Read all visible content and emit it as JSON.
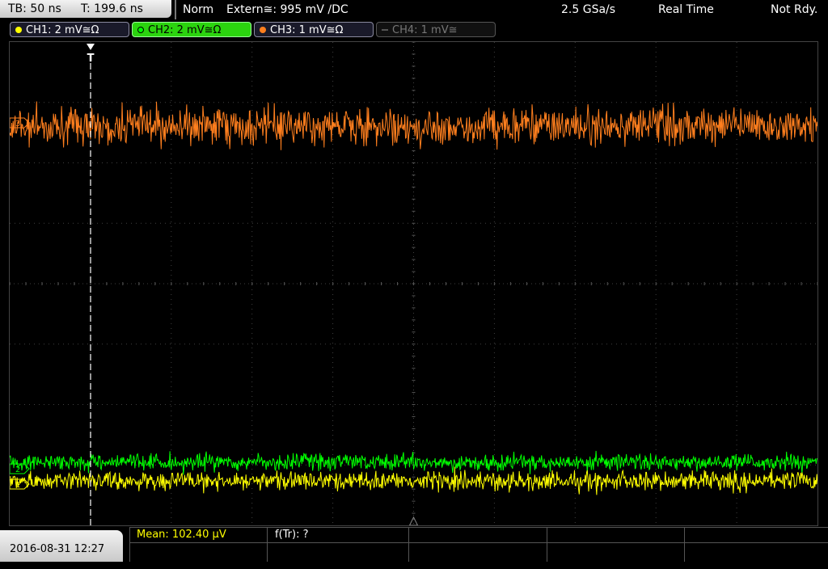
{
  "header": {
    "timebase": "TB: 50 ns",
    "trigger_time": "T: 199.6 ns",
    "trigger_mode": "Norm",
    "trigger_source": "Extern≅: 995 mV ∕DC",
    "sample_rate": "2.5 GSa/s",
    "acq_mode": "Real Time",
    "status": "Not Rdy."
  },
  "channels": [
    {
      "label": "CH1: 2 mV≅Ω",
      "color": "#ffff00",
      "active": true
    },
    {
      "label": "CH2: 2 mV≅Ω",
      "color": "#00ff00",
      "active": true,
      "selected": true
    },
    {
      "label": "CH3: 1 mV≅Ω",
      "color": "#ff7f1e",
      "active": true
    },
    {
      "label": "CH4: 1 mV≅",
      "color": "#777777",
      "active": false
    }
  ],
  "markers": {
    "trigger_marker": "T",
    "ch3_marker": "3",
    "ch2_marker": "2",
    "ch1_marker": "1"
  },
  "measurements": {
    "mean": "Mean: 102.40 µV",
    "rise_freq": "f(Tr): ?"
  },
  "footer": {
    "datetime": "2016-08-31 12:27"
  },
  "colors": {
    "ch1": "#ffff00",
    "ch2": "#00ff00",
    "ch3": "#ff7f1e",
    "grid": "#404040",
    "background": "#000000"
  }
}
